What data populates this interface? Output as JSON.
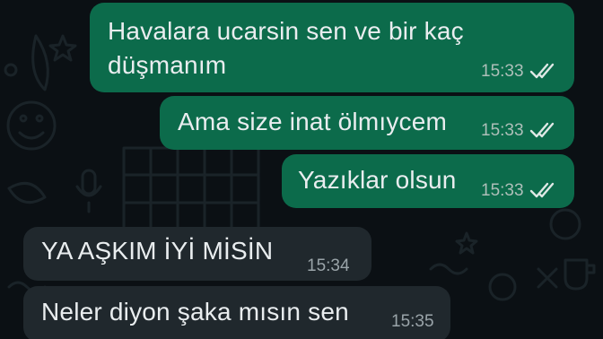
{
  "messages": [
    {
      "direction": "outgoing",
      "line1": "Havalara ucarsin sen ve bir kaç",
      "line2": "düşmanım",
      "time": "15:33",
      "status": "read"
    },
    {
      "direction": "outgoing",
      "text": "Ama size inat ölmıycem",
      "time": "15:33",
      "status": "read"
    },
    {
      "direction": "outgoing",
      "text": "Yazıklar olsun",
      "time": "15:33",
      "status": "read"
    },
    {
      "direction": "incoming",
      "text": "YA AŞKIM İYİ MİSİN",
      "time": "15:34"
    },
    {
      "direction": "incoming",
      "text": "Neler diyon şaka mısın sen",
      "time": "15:35"
    }
  ],
  "colors": {
    "background": "#0b1014",
    "outgoing_bubble": "#0c6b4b",
    "incoming_bubble": "#20282d",
    "text": "#e9edef",
    "timestamp": "#aebfb9"
  },
  "icons": {
    "read_receipt": "double-check-icon",
    "wallpaper": "chat-doodle-wallpaper"
  }
}
